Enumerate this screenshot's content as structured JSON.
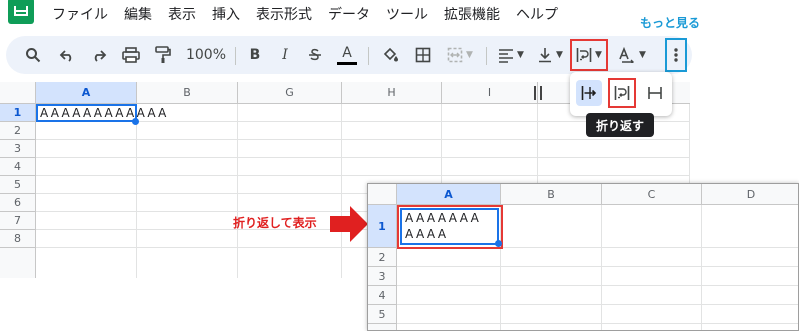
{
  "menu": [
    "ファイル",
    "編集",
    "表示",
    "挿入",
    "表示形式",
    "データ",
    "ツール",
    "拡張機能",
    "ヘルプ"
  ],
  "toolbar": {
    "zoom": "100%",
    "bold": "B",
    "italic": "I",
    "text_color_letter": "A",
    "more_text": "もっと見る"
  },
  "wrap_menu": {
    "tooltip": "折り返す",
    "options": [
      "overflow",
      "wrap",
      "clip"
    ],
    "selected": "wrap"
  },
  "sheet": {
    "columns": [
      "A",
      "B",
      "G",
      "H",
      "I"
    ],
    "rows": [
      "1",
      "2",
      "3",
      "4",
      "5",
      "6",
      "7",
      "8"
    ],
    "cell_a1": "AAAAAAAAAAAA"
  },
  "zoomed": {
    "columns": [
      "A",
      "B",
      "C",
      "D"
    ],
    "rows": [
      "1",
      "2",
      "3",
      "4",
      "5"
    ],
    "cell_a1_line1": "AAAAAAA",
    "cell_a1_line2": "AAAA"
  },
  "annotation": "折り返して表示",
  "colors": {
    "accent_red": "#e53935",
    "accent_blue": "#1a9ad6",
    "selection": "#1a73e8",
    "sheets_green": "#0f9d58"
  }
}
